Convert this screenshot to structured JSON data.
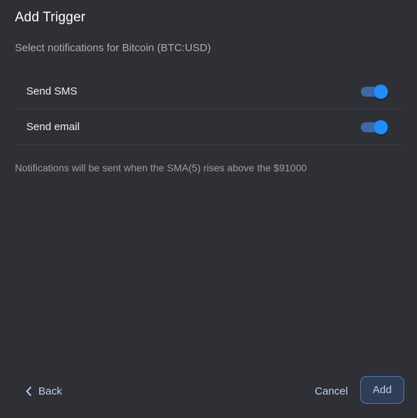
{
  "dialog": {
    "title": "Add Trigger",
    "subtitle": "Select notifications for Bitcoin (BTC:USD)",
    "options": [
      {
        "label": "Send SMS",
        "enabled": true
      },
      {
        "label": "Send email",
        "enabled": true
      }
    ],
    "info": "Notifications will be sent when the SMA(5) rises above the $91000"
  },
  "footer": {
    "back_label": "Back",
    "cancel_label": "Cancel",
    "add_label": "Add",
    "back_icon": "chevron-left-icon"
  },
  "colors": {
    "background": "#2f3035",
    "toggle_on": "#1f8dff",
    "toggle_track": "#3d6aa6",
    "link": "#b9d0f2"
  }
}
